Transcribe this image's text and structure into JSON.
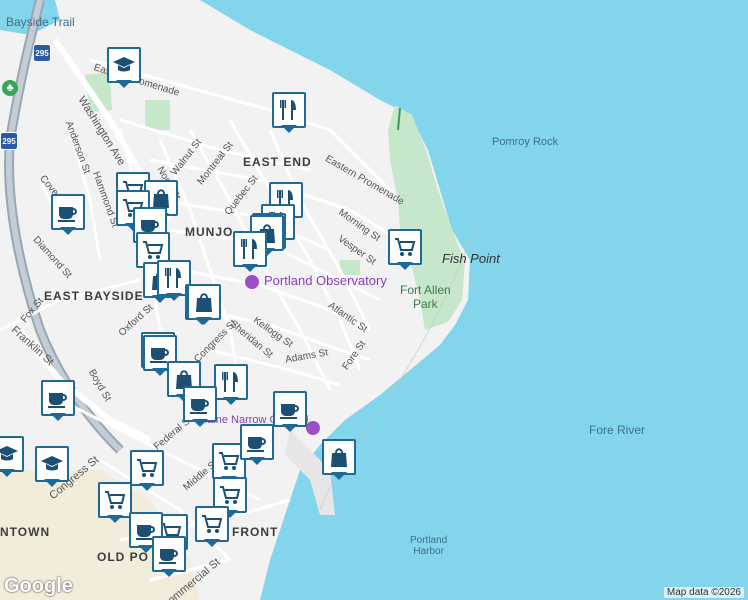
{
  "labels": {
    "water": {
      "bayside_trail": "Bayside Trail",
      "pomroy_rock": "Pomroy Rock",
      "fore_river": "Fore River",
      "portland_harbor": "Portland\nHarbor",
      "fish_point": "Fish Point"
    },
    "parks": {
      "fort_allen": "Fort Allen\nPark"
    },
    "neighborhoods": {
      "east_end": "EAST END",
      "munjoy": "MUNJO",
      "east_bayside": "EAST BAYSIDE",
      "downtown": "NTOWN",
      "old_port": "OLD PO",
      "waterfront": "FRONT"
    },
    "places": {
      "portland_observatory": "Portland Observatory",
      "maine_narrow_gauge": "Maine Narrow Gauge Railroad"
    },
    "streets": {
      "eastern_promenade_top": "Eastern Promenade",
      "eastern_promenade_right": "Eastern Promenade",
      "washington_ave": "Washington Ave",
      "walnut": "Walnut St",
      "montreal": "Montreal St",
      "north": "North St",
      "anderson": "Anderson St",
      "hammond": "Hammond St",
      "cove": "Cove St",
      "quebec": "Quebec St",
      "morning": "Morning St",
      "vesper": "Vesper St",
      "diamond": "Diamond St",
      "fox": "Fox St",
      "oxford": "Oxford St",
      "atlantic": "Atlantic St",
      "kellogg": "Kellogg St",
      "sheridan": "Sheridan St",
      "congress_1": "Congress St",
      "adams": "Adams St",
      "fore": "Fore St",
      "boyd": "Boyd St",
      "franklin": "Franklin St",
      "federal": "Federal St",
      "middle": "Middle St",
      "congress_2": "Congress St",
      "commercial": "Commercial St",
      "bayside_st": "St"
    }
  },
  "highway_shield": {
    "i295_top": "295",
    "i295_left": "295"
  },
  "pois": [
    {
      "type": "school-icon"
    },
    {
      "type": "restaurant-icon"
    },
    {
      "type": "cafe-icon"
    },
    {
      "type": "shopping-cart-icon"
    },
    {
      "type": "shopping-bag-icon"
    },
    {
      "type": "restaurant-icon"
    },
    {
      "type": "restaurant-icon"
    },
    {
      "type": "shopping-cart-icon"
    },
    {
      "type": "cafe-icon"
    },
    {
      "type": "restaurant-icon"
    },
    {
      "type": "shopping-bag-icon"
    },
    {
      "type": "restaurant-icon"
    },
    {
      "type": "shopping-cart-icon"
    },
    {
      "type": "shopping-bag-icon"
    },
    {
      "type": "restaurant-icon"
    },
    {
      "type": "cafe-icon"
    },
    {
      "type": "shopping-bag-icon"
    },
    {
      "type": "school-icon"
    },
    {
      "type": "cafe-icon"
    },
    {
      "type": "shopping-cart-icon"
    },
    {
      "type": "shopping-bag-icon"
    },
    {
      "type": "restaurant-icon"
    },
    {
      "type": "cafe-icon"
    },
    {
      "type": "cafe-icon"
    },
    {
      "type": "cafe-icon"
    },
    {
      "type": "school-icon"
    },
    {
      "type": "shopping-cart-icon"
    },
    {
      "type": "shopping-cart-icon"
    },
    {
      "type": "shopping-cart-icon"
    },
    {
      "type": "shopping-cart-icon"
    },
    {
      "type": "shopping-bag-icon"
    },
    {
      "type": "shopping-cart-icon"
    },
    {
      "type": "shopping-cart-icon"
    },
    {
      "type": "cafe-icon"
    },
    {
      "type": "cafe-icon"
    },
    {
      "type": "cafe-icon"
    },
    {
      "type": "school-icon"
    }
  ],
  "attribution": "Map data ©2026",
  "logo": "Google",
  "colors": {
    "water": "#83d5ec",
    "land": "#f2f2f2",
    "park": "#c6e7c9",
    "poi_border": "#1d6a99",
    "highway": "#9aa6b4"
  }
}
